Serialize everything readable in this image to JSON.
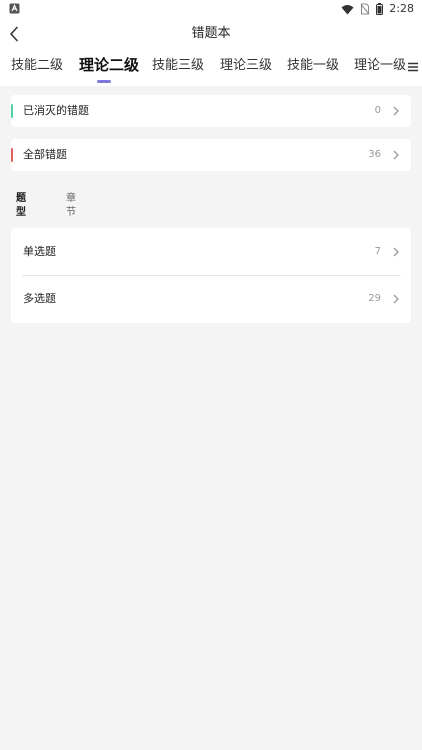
{
  "status_bar": {
    "time": "2:28"
  },
  "header": {
    "title": "错题本"
  },
  "tabs": [
    {
      "label": "技能二级"
    },
    {
      "label": "理论二级"
    },
    {
      "label": "技能三级"
    },
    {
      "label": "理论三级"
    },
    {
      "label": "技能一级"
    },
    {
      "label": "理论一级"
    }
  ],
  "summary": {
    "eliminated": {
      "label": "已消灭的错题",
      "count": "0"
    },
    "all": {
      "label": "全部错题",
      "count": "36"
    }
  },
  "filter": {
    "type_label": "题型",
    "chapter_label": "章节"
  },
  "categories": [
    {
      "label": "单选题",
      "count": "7"
    },
    {
      "label": "多选题",
      "count": "29"
    }
  ],
  "colors": {
    "accent_indicator": "#7d7bdc",
    "bar_green": "#4fd3a6",
    "bar_red": "#e0605f"
  }
}
